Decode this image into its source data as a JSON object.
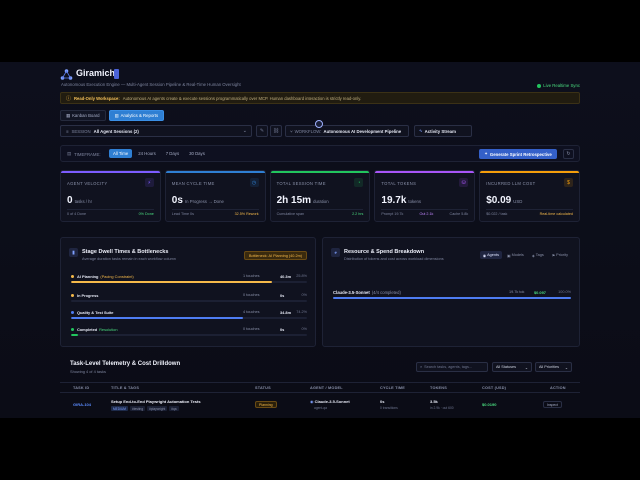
{
  "header": {
    "brand": "Giramichi",
    "tagline": "Autonomous Execution Engine — Multi-Agent Session Pipeline & Real-Time Human Oversight",
    "sync_label": "Live Realtime Sync"
  },
  "notice": {
    "title": "Read-Only Workspace:",
    "text": "Autonomous AI agents create & execute sessions programmatically over MCP. Human dashboard interaction is strictly read-only."
  },
  "tabs": [
    {
      "label": "Kanban Board"
    },
    {
      "label": "Analytics & Reports"
    }
  ],
  "session": {
    "label": "SESSION",
    "value": "All Agent Sessions (2)",
    "workflow_label": "WORKFLOW:",
    "workflow_value": "Autonomous AI Development Pipeline",
    "activity_label": "Activity Stream"
  },
  "timeframe": {
    "label": "TIMEFRAME:",
    "options": [
      "All Time",
      "24 Hours",
      "7 Days",
      "30 Days"
    ],
    "generate_label": "Generate Sprint Retrospective"
  },
  "metrics": [
    {
      "label": "AGENT VELOCITY",
      "value": "0",
      "unit": "tasks / hr",
      "foot_left": "0 of 4 Done",
      "foot_right": "0% Done",
      "accent": "#7c5cff",
      "foot_right_color": "#4ade80"
    },
    {
      "label": "MEAN CYCLE TIME",
      "value": "0s",
      "unit": "In Progress → Done",
      "foot_left": "Lead Time 0s",
      "foot_right": "32.5% Rework",
      "accent": "#2f7fd3",
      "foot_right_color": "#f5b94a"
    },
    {
      "label": "TOTAL SESSION TIME",
      "value": "2h 15m",
      "unit": "duration",
      "foot_left": "Cumulative span",
      "foot_right": "2.2 hrs",
      "accent": "#22c55e",
      "foot_right_color": "#4ade80"
    },
    {
      "label": "TOTAL TOKENS",
      "value": "19.7k",
      "unit": "tokens",
      "foot_left": "Prompt 19.7k",
      "foot_mid": "Out 2.1k",
      "foot_right": "Cache 5.8k",
      "accent": "#a855f7",
      "foot_right_color": "#7e859f"
    },
    {
      "label": "INCURRED LLM COST",
      "value": "$0.09",
      "unit": "USD",
      "foot_left": "$0.022 / task",
      "foot_right": "Real-time calculated",
      "accent": "#f59e0b",
      "foot_right_color": "#f5b94a"
    }
  ],
  "stages": {
    "title": "Stage Dwell Times & Bottlenecks",
    "subtitle": "Average duration tasks remain in each workflow column",
    "bottleneck": "Bottleneck: AI Planning (40.2m)",
    "items": [
      {
        "name": "AI Planning",
        "tag": "(Pacing Constraint)",
        "touches": "1 touches",
        "time": "40.3m",
        "pct": "25.8%",
        "fill": 0.85,
        "color": "#f5b94a",
        "tag_color": "#f5b94a"
      },
      {
        "name": "In Progress",
        "tag": "",
        "touches": "0 touches",
        "time": "0s",
        "pct": "0%",
        "fill": 0.0,
        "color": "#f5b94a",
        "tag_color": "#8a91aa"
      },
      {
        "name": "Quality & Test Suite",
        "tag": "",
        "touches": "4 touches",
        "time": "34.8m",
        "pct": "74.2%",
        "fill": 0.73,
        "color": "#4e7cf2",
        "tag_color": "#8a91aa"
      },
      {
        "name": "Completed",
        "tag": "Resolution",
        "touches": "0 touches",
        "time": "0s",
        "pct": "0%",
        "fill": 0.03,
        "color": "#22c55e",
        "tag_color": "#4ade80"
      }
    ]
  },
  "resources": {
    "title": "Resource & Spend Breakdown",
    "subtitle": "Distribution of tokens and cost across workload dimensions",
    "segments": [
      "Agents",
      "Models",
      "Tags",
      "Priority"
    ],
    "row": {
      "name": "Claude-3.5-Sonnet",
      "sub": "(4/4 completed)",
      "tokens": "19.7k tok",
      "cost": "$0.097",
      "pct": "100.0%",
      "fill": 1.0
    }
  },
  "table": {
    "title": "Task-Level Telemetry & Cost Drilldown",
    "subtitle": "Showing 4 of 4 tasks",
    "search_placeholder": "Search tasks, agents, tags...",
    "status_filter": "All Statuses",
    "priority_filter": "All Priorities",
    "headers": [
      "TASK ID",
      "TITLE & TAGS",
      "STATUS",
      "AGENT / MODEL",
      "CYCLE TIME",
      "TOKENS",
      "COST (USD)",
      "ACTION"
    ],
    "rows": [
      {
        "id": "GIRA-104",
        "title": "Setup End-to-End Playwright Automation Tests",
        "tags": [
          "MEDIUM",
          "#testing",
          "#playwright",
          "#qa"
        ],
        "status": "Planning",
        "agent": "Claude-3.5-Sonnet",
        "agent_sub": "agent-qa",
        "cycle": "0s",
        "cycle_sub": "0 transitions",
        "tokens": "3.5k",
        "tokens_sub": "in 2.9k · out 600",
        "cost": "$0.0190",
        "action": "Inspect"
      }
    ]
  }
}
